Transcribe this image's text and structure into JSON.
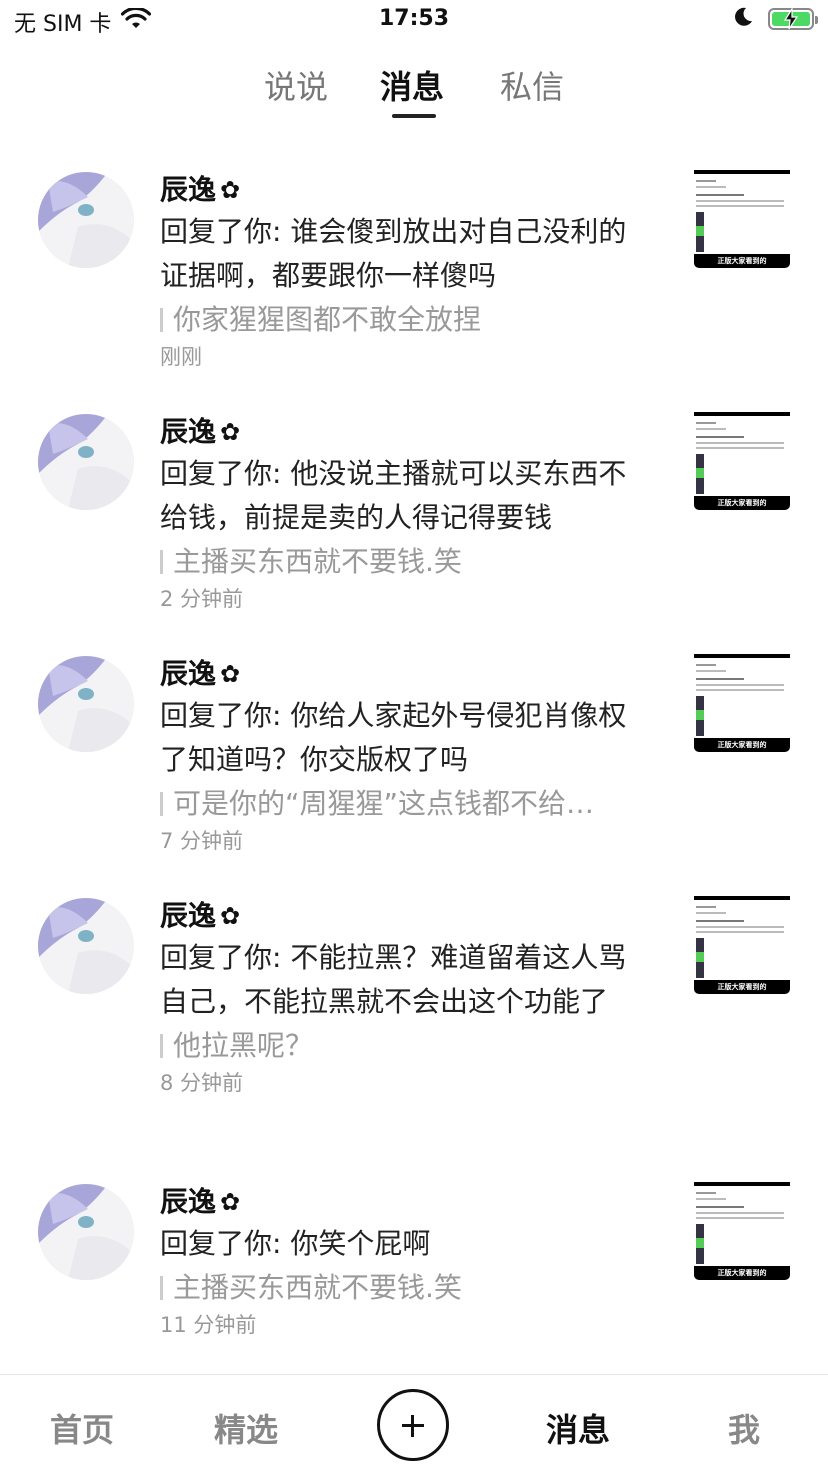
{
  "status_bar": {
    "carrier": "无 SIM 卡",
    "time": "17:53",
    "icons": [
      "wifi-icon",
      "moon-icon",
      "battery-charging-icon"
    ]
  },
  "top_tabs": [
    {
      "label": "说说",
      "active": false
    },
    {
      "label": "消息",
      "active": true
    },
    {
      "label": "私信",
      "active": false
    }
  ],
  "messages": [
    {
      "name": "辰逸",
      "name_suffix": "✿",
      "text": "回复了你: 谁会傻到放出对自己没利的证据啊，都要跟你一样傻吗",
      "quote": "你家猩猩图都不敢全放捏",
      "time": "刚刚",
      "thumb_caption": "正版大家看到的"
    },
    {
      "name": "辰逸",
      "name_suffix": "✿",
      "text": "回复了你: 他没说主播就可以买东西不给钱，前提是卖的人得记得要钱",
      "quote": "主播买东西就不要钱.笑",
      "time": "2 分钟前",
      "thumb_caption": "正版大家看到的"
    },
    {
      "name": "辰逸",
      "name_suffix": "✿",
      "text": "回复了你: 你给人家起外号侵犯肖像权了知道吗？你交版权了吗",
      "quote": "可是你的“周猩猩”这点钱都不给…",
      "time": "7 分钟前",
      "thumb_caption": "正版大家看到的"
    },
    {
      "name": "辰逸",
      "name_suffix": "✿",
      "text": "回复了你: 不能拉黑？难道留着这人骂自己，不能拉黑就不会出这个功能了",
      "quote": "他拉黑呢？",
      "time": "8 分钟前",
      "thumb_caption": "正版大家看到的"
    },
    {
      "name": "辰逸",
      "name_suffix": "✿",
      "text": "回复了你: 你笑个屁啊",
      "quote": "主播买东西就不要钱.笑",
      "time": "11 分钟前",
      "thumb_caption": "正版大家看到的"
    }
  ],
  "bottom_nav": [
    {
      "label": "首页",
      "active": false
    },
    {
      "label": "精选",
      "active": false
    },
    {
      "label": "+",
      "icon": "plus-icon"
    },
    {
      "label": "消息",
      "active": true
    },
    {
      "label": "我",
      "active": false
    }
  ]
}
